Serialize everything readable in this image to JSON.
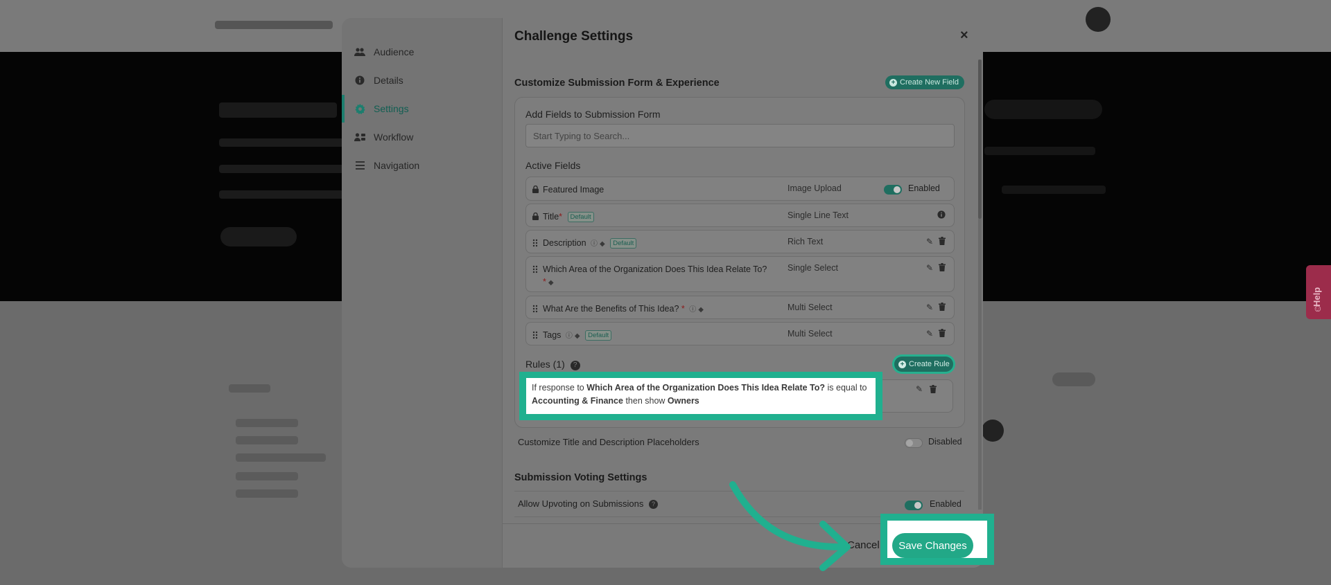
{
  "modal": {
    "title": "Challenge Settings",
    "close_icon": "×",
    "sidebar": {
      "items": [
        {
          "label": "Audience",
          "icon": "users-icon"
        },
        {
          "label": "Details",
          "icon": "info-icon"
        },
        {
          "label": "Settings",
          "icon": "gear-icon",
          "active": true
        },
        {
          "label": "Workflow",
          "icon": "workflow-icon"
        },
        {
          "label": "Navigation",
          "icon": "menu-icon"
        }
      ]
    },
    "customize": {
      "title": "Customize Submission Form & Experience",
      "create_field_label": "Create New Field",
      "add_fields_label": "Add Fields to Submission Form",
      "search_placeholder": "Start Typing to Search...",
      "active_fields_label": "Active Fields",
      "fields": [
        {
          "name": "Featured Image",
          "type": "Image Upload",
          "status": "Enabled"
        },
        {
          "name": "Title",
          "required": "*",
          "badge": "Default",
          "type": "Single Line Text"
        },
        {
          "name": "Description",
          "badge": "Default",
          "type": "Rich Text"
        },
        {
          "name": "Which Area of the Organization Does This Idea Relate To?",
          "required": "*",
          "type": "Single Select"
        },
        {
          "name": "What Are the Benefits of This Idea?",
          "required": "*",
          "type": "Multi Select"
        },
        {
          "name": "Tags",
          "badge": "Default",
          "type": "Multi Select"
        }
      ],
      "rules_label": "Rules (1)",
      "create_rule_label": "Create Rule",
      "rule": {
        "prefix": "If response to",
        "question": "Which Area of the Organization Does This Idea Relate To?",
        "middle": "is equal to",
        "answer": "Accounting & Finance",
        "then": "then show",
        "target": "Owners"
      }
    },
    "placeholders": {
      "label": "Customize Title and Description Placeholders",
      "status": "Disabled"
    },
    "voting": {
      "title": "Submission Voting Settings",
      "upvote_label": "Allow Upvoting on Submissions",
      "upvote_status": "Enabled"
    },
    "footer": {
      "cancel_label": "Cancel",
      "save_label": "Save Changes"
    }
  },
  "help_tab": {
    "label": "Help"
  },
  "colors": {
    "accent": "#20b08f",
    "brand_green": "#1f6e60",
    "help_tab": "#9c2c4b"
  }
}
